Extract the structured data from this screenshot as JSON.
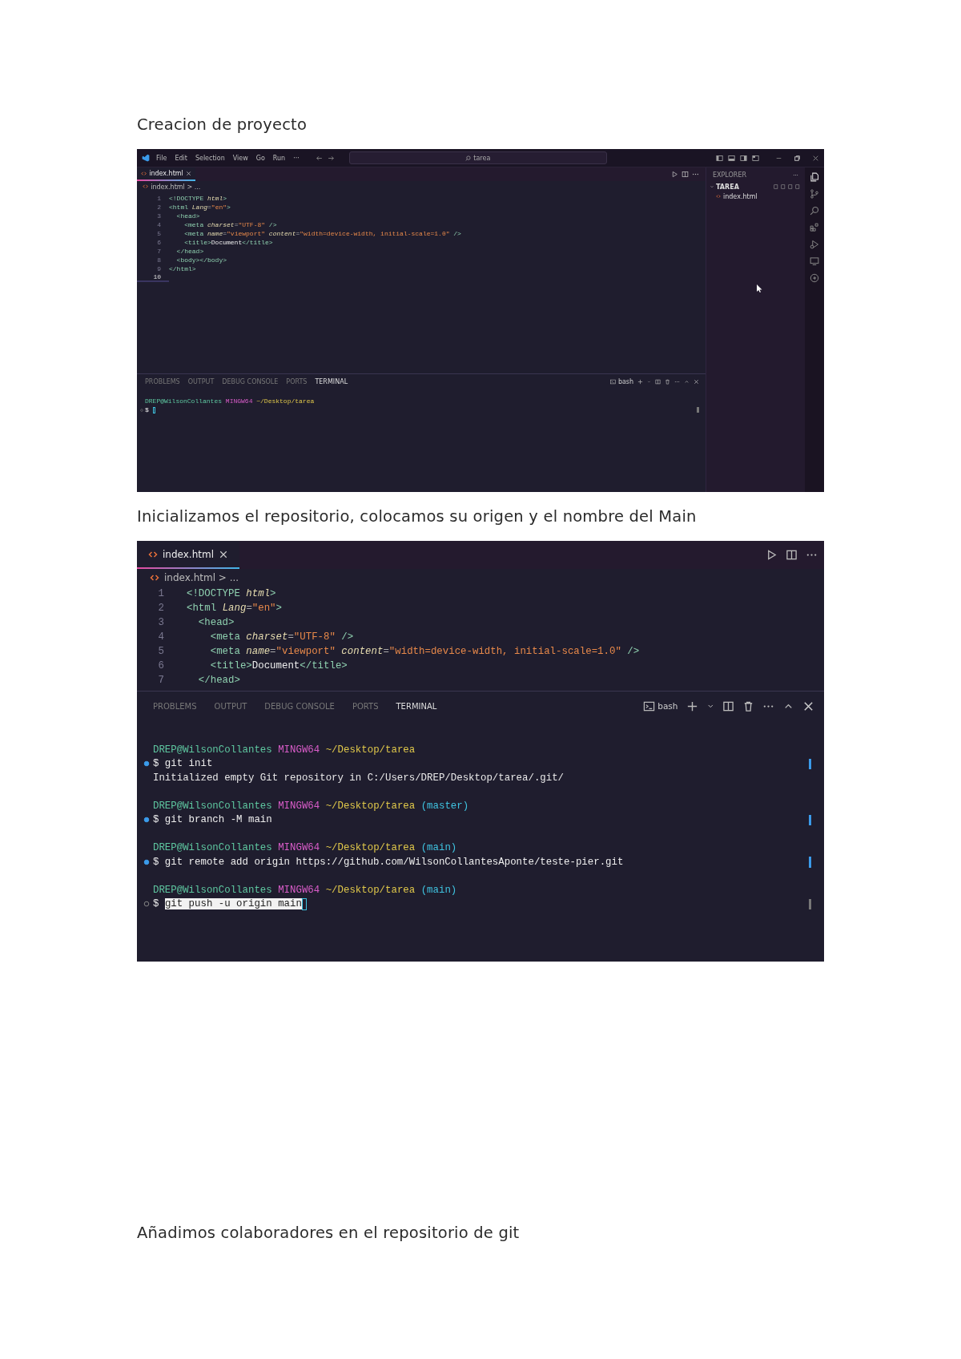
{
  "sections": [
    {
      "heading": "Creacion de proyecto",
      "screenshot": {
        "kind": "full",
        "titlebar": {
          "menu": [
            "File",
            "Edit",
            "Selection",
            "View",
            "Go",
            "Run",
            "···"
          ],
          "search": "tarea"
        },
        "tabs": [
          {
            "label": "index.html",
            "selected": true
          }
        ],
        "breadcrumb": "index.html > ...",
        "code": [
          {
            "number": "1",
            "current": false,
            "tokens": [
              {
                "kind": "tag",
                "text": "<!DOCTYPE "
              },
              {
                "kind": "attr",
                "text": "html"
              },
              {
                "kind": "tag",
                "text": ">"
              }
            ]
          },
          {
            "number": "2",
            "current": false,
            "tokens": [
              {
                "kind": "tag",
                "text": "<html "
              },
              {
                "kind": "attr",
                "text": "Lang"
              },
              {
                "kind": "punct",
                "text": "="
              },
              {
                "kind": "string",
                "text": "\"en\""
              },
              {
                "kind": "tag",
                "text": ">"
              }
            ]
          },
          {
            "number": "3",
            "current": false,
            "tokens": [
              {
                "kind": "tag",
                "text": "  <head>"
              }
            ]
          },
          {
            "number": "4",
            "current": false,
            "tokens": [
              {
                "kind": "tag",
                "text": "    <meta "
              },
              {
                "kind": "attr",
                "text": "charset"
              },
              {
                "kind": "punct",
                "text": "="
              },
              {
                "kind": "string",
                "text": "\"UTF-8\""
              },
              {
                "kind": "tag",
                "text": " />"
              }
            ]
          },
          {
            "number": "5",
            "current": false,
            "tokens": [
              {
                "kind": "tag",
                "text": "    <meta "
              },
              {
                "kind": "attr",
                "text": "name"
              },
              {
                "kind": "punct",
                "text": "="
              },
              {
                "kind": "string",
                "text": "\"viewport\""
              },
              {
                "kind": "attr",
                "text": " content"
              },
              {
                "kind": "punct",
                "text": "="
              },
              {
                "kind": "string",
                "text": "\"width=device-width, initial-scale=1.0\""
              },
              {
                "kind": "tag",
                "text": " />"
              }
            ]
          },
          {
            "number": "6",
            "current": false,
            "tokens": [
              {
                "kind": "tag",
                "text": "    <title>"
              },
              {
                "kind": "text",
                "text": "Document"
              },
              {
                "kind": "tag",
                "text": "</title>"
              }
            ]
          },
          {
            "number": "7",
            "current": false,
            "tokens": [
              {
                "kind": "tag",
                "text": "  </head>"
              }
            ]
          },
          {
            "number": "8",
            "current": false,
            "tokens": [
              {
                "kind": "tag",
                "text": "  <body></body>"
              }
            ]
          },
          {
            "number": "9",
            "current": false,
            "tokens": [
              {
                "kind": "tag",
                "text": "</html>"
              }
            ]
          },
          {
            "number": "10",
            "current": true
          }
        ],
        "explorer": {
          "title": "EXPLORER",
          "folder": {
            "name": "TAREA",
            "expanded": true,
            "files": [
              "index.html"
            ]
          }
        },
        "panel_tabs": [
          {
            "label": "PROBLEMS",
            "selected": false
          },
          {
            "label": "OUTPUT",
            "selected": false
          },
          {
            "label": "DEBUG CONSOLE",
            "selected": false
          },
          {
            "label": "PORTS",
            "selected": false
          },
          {
            "label": "TERMINAL",
            "selected": true
          }
        ],
        "shell": "bash",
        "terminal": [
          {
            "kind": "prompt",
            "user": "DREP@WilsonCollantes",
            "system": "MINGW64",
            "path": "~/Desktop/tarea"
          },
          {
            "kind": "command",
            "finished": false,
            "text": "$ ",
            "cursor": true
          }
        ]
      }
    },
    {
      "heading": "Inicializamos el repositorio, colocamos su origen y el nombre del Main",
      "screenshot": {
        "kind": "zoomed",
        "tabs": [
          {
            "label": "index.html",
            "selected": true
          }
        ],
        "breadcrumb": "index.html > ...",
        "code": [
          {
            "number": "1",
            "current": false,
            "tokens": [
              {
                "kind": "tag",
                "text": "<!DOCTYPE "
              },
              {
                "kind": "attr",
                "text": "html"
              },
              {
                "kind": "tag",
                "text": ">"
              }
            ]
          },
          {
            "number": "2",
            "current": false,
            "tokens": [
              {
                "kind": "tag",
                "text": "<html "
              },
              {
                "kind": "attr",
                "text": "Lang"
              },
              {
                "kind": "punct",
                "text": "="
              },
              {
                "kind": "string",
                "text": "\"en\""
              },
              {
                "kind": "tag",
                "text": ">"
              }
            ]
          },
          {
            "number": "3",
            "current": false,
            "tokens": [
              {
                "kind": "tag",
                "text": "  <head>"
              }
            ]
          },
          {
            "number": "4",
            "current": false,
            "tokens": [
              {
                "kind": "tag",
                "text": "    <meta "
              },
              {
                "kind": "attr",
                "text": "charset"
              },
              {
                "kind": "punct",
                "text": "="
              },
              {
                "kind": "string",
                "text": "\"UTF-8\""
              },
              {
                "kind": "tag",
                "text": " />"
              }
            ]
          },
          {
            "number": "5",
            "current": false,
            "tokens": [
              {
                "kind": "tag",
                "text": "    <meta "
              },
              {
                "kind": "attr",
                "text": "name"
              },
              {
                "kind": "punct",
                "text": "="
              },
              {
                "kind": "string",
                "text": "\"viewport\""
              },
              {
                "kind": "attr",
                "text": " content"
              },
              {
                "kind": "punct",
                "text": "="
              },
              {
                "kind": "string",
                "text": "\"width=device-width, initial-scale=1.0\""
              },
              {
                "kind": "tag",
                "text": " />"
              }
            ]
          },
          {
            "number": "6",
            "current": false,
            "tokens": [
              {
                "kind": "tag",
                "text": "    <title>"
              },
              {
                "kind": "text",
                "text": "Document"
              },
              {
                "kind": "tag",
                "text": "</title>"
              }
            ]
          },
          {
            "number": "7",
            "current": false,
            "tokens": [
              {
                "kind": "tag",
                "text": "  </head>"
              }
            ]
          }
        ],
        "panel_tabs": [
          {
            "label": "PROBLEMS",
            "selected": false
          },
          {
            "label": "OUTPUT",
            "selected": false
          },
          {
            "label": "DEBUG CONSOLE",
            "selected": false
          },
          {
            "label": "PORTS",
            "selected": false
          },
          {
            "label": "TERMINAL",
            "selected": true
          }
        ],
        "shell": "bash",
        "terminal": [
          {
            "kind": "prompt",
            "user": "DREP@WilsonCollantes",
            "system": "MINGW64",
            "path": "~/Desktop/tarea"
          },
          {
            "kind": "command",
            "finished": true,
            "text": "$ git init"
          },
          {
            "kind": "output",
            "text": "Initialized empty Git repository in C:/Users/DREP/Desktop/tarea/.git/"
          },
          {
            "kind": "prompt",
            "user": "DREP@WilsonCollantes",
            "system": "MINGW64",
            "path": "~/Desktop/tarea",
            "branch": "(master)"
          },
          {
            "kind": "command",
            "finished": true,
            "text": "$ git branch -M main"
          },
          {
            "kind": "prompt",
            "user": "DREP@WilsonCollantes",
            "system": "MINGW64",
            "path": "~/Desktop/tarea",
            "branch": "(main)"
          },
          {
            "kind": "command",
            "finished": true,
            "text": "$ git remote add origin https://github.com/WilsonCollantesAponte/teste-pier.git"
          },
          {
            "kind": "prompt",
            "user": "DREP@WilsonCollantes",
            "system": "MINGW64",
            "path": "~/Desktop/tarea",
            "branch": "(main)"
          },
          {
            "kind": "command",
            "finished": false,
            "text": "$ ",
            "highlight": "git push -u origin main",
            "cursor": true
          }
        ]
      }
    },
    {
      "heading": "Añadimos colaboradores en el repositorio de git"
    }
  ]
}
